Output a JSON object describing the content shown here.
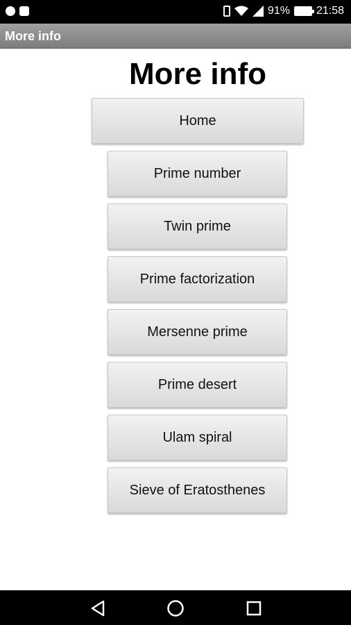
{
  "status_bar": {
    "battery_percent": "91%",
    "time": "21:58"
  },
  "action_bar": {
    "title": "More info"
  },
  "page": {
    "title": "More info",
    "buttons": [
      "Home",
      "Prime number",
      "Twin prime",
      "Prime factorization",
      "Mersenne prime",
      "Prime desert",
      "Ulam spiral",
      "Sieve of Eratosthenes"
    ]
  },
  "colors": {
    "action_bar": "#8e8e8e",
    "status_bar": "#000000",
    "button_bg": "#e6e6e6"
  },
  "icons": {
    "nav_back": "back-triangle-icon",
    "nav_home": "home-circle-icon",
    "nav_recent": "recent-square-icon"
  }
}
